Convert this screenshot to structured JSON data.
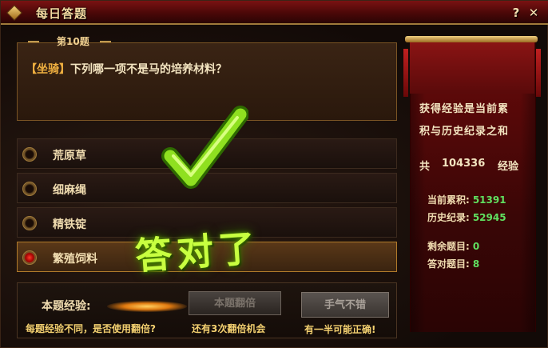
{
  "window": {
    "title": "每日答题",
    "help_icon": "?",
    "close_icon": "✕"
  },
  "question": {
    "number_label": "第10题",
    "category": "【坐骑】",
    "text": "下列哪一项不是马的培养材料？"
  },
  "options": [
    {
      "label": "荒原草",
      "selected": false
    },
    {
      "label": "细麻绳",
      "selected": false
    },
    {
      "label": "精铁锭",
      "selected": false
    },
    {
      "label": "繁殖饲料",
      "selected": true
    }
  ],
  "result": {
    "correct_text": "答对了",
    "mark_icon": "check-mark-icon",
    "mark_color": "#8fe020"
  },
  "bottom": {
    "exp_label": "本题经验:",
    "double_button": "本题翻倍",
    "note_left": "每题经验不同，是否使用翻倍?",
    "note_right": "还有3次翻倍机会",
    "luck_button": "手气不错",
    "luck_note": "有一半可能正确!"
  },
  "side": {
    "rule_line1": "获得经验是当前累",
    "rule_line2": "积与历史纪录之和",
    "total_prefix": "共",
    "total_value": "104336",
    "total_unit": "经验",
    "current_label": "当前累积:",
    "current_value": "51391",
    "history_label": "历史纪录:",
    "history_value": "52945",
    "remaining_label": "剩余题目:",
    "remaining_value": "0",
    "correct_label": "答对题目:",
    "correct_value": "8"
  }
}
